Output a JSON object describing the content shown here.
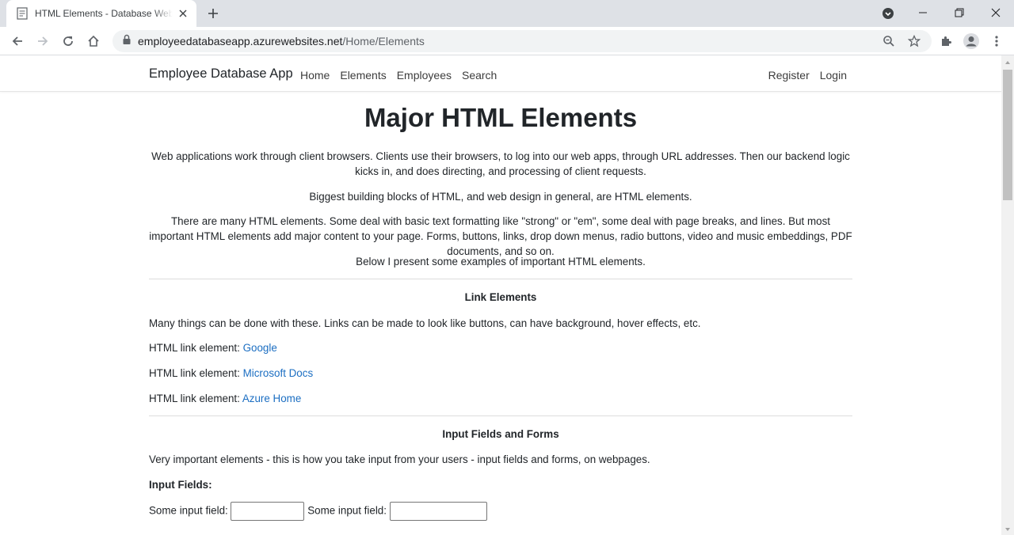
{
  "browser": {
    "tab_title": "HTML Elements - Database Web App",
    "url_host": "employeedatabaseapp.azurewebsites.net",
    "url_path": "/Home/Elements"
  },
  "navbar": {
    "brand": "Employee Database App",
    "links": [
      "Home",
      "Elements",
      "Employees",
      "Search"
    ],
    "right_links": [
      "Register",
      "Login"
    ]
  },
  "page": {
    "title": "Major HTML Elements",
    "intro": [
      "Web applications work through client browsers. Clients use their browsers, to log into our web apps, through URL addresses. Then our backend logic kicks in, and does directing, and processing of client requests.",
      "Biggest building blocks of HTML, and web design in general, are HTML elements.",
      "There are many HTML elements. Some deal with basic text formatting like \"strong\" or \"em\", some deal with page breaks, and lines. But most important HTML elements add major content to your page. Forms, buttons, links, drop down menus, radio buttons, video and music embeddings, PDF documents, and so on.",
      "Below I present some examples of important HTML elements."
    ],
    "links_section": {
      "heading": "Link Elements",
      "description": "Many things can be done with these. Links can be made to look like buttons, can have background, hover effects, etc.",
      "label": "HTML link element:",
      "links": [
        "Google",
        "Microsoft Docs",
        "Azure Home"
      ]
    },
    "inputs_section": {
      "heading": "Input Fields and Forms",
      "description": "Very important elements - this is how you take input from your users - input fields and forms, on webpages.",
      "subheading": "Input Fields:",
      "field_label": "Some input field:"
    }
  },
  "colors": {
    "link": "#1b6ec2",
    "text": "#212529",
    "tabstrip": "#dee1e6"
  }
}
